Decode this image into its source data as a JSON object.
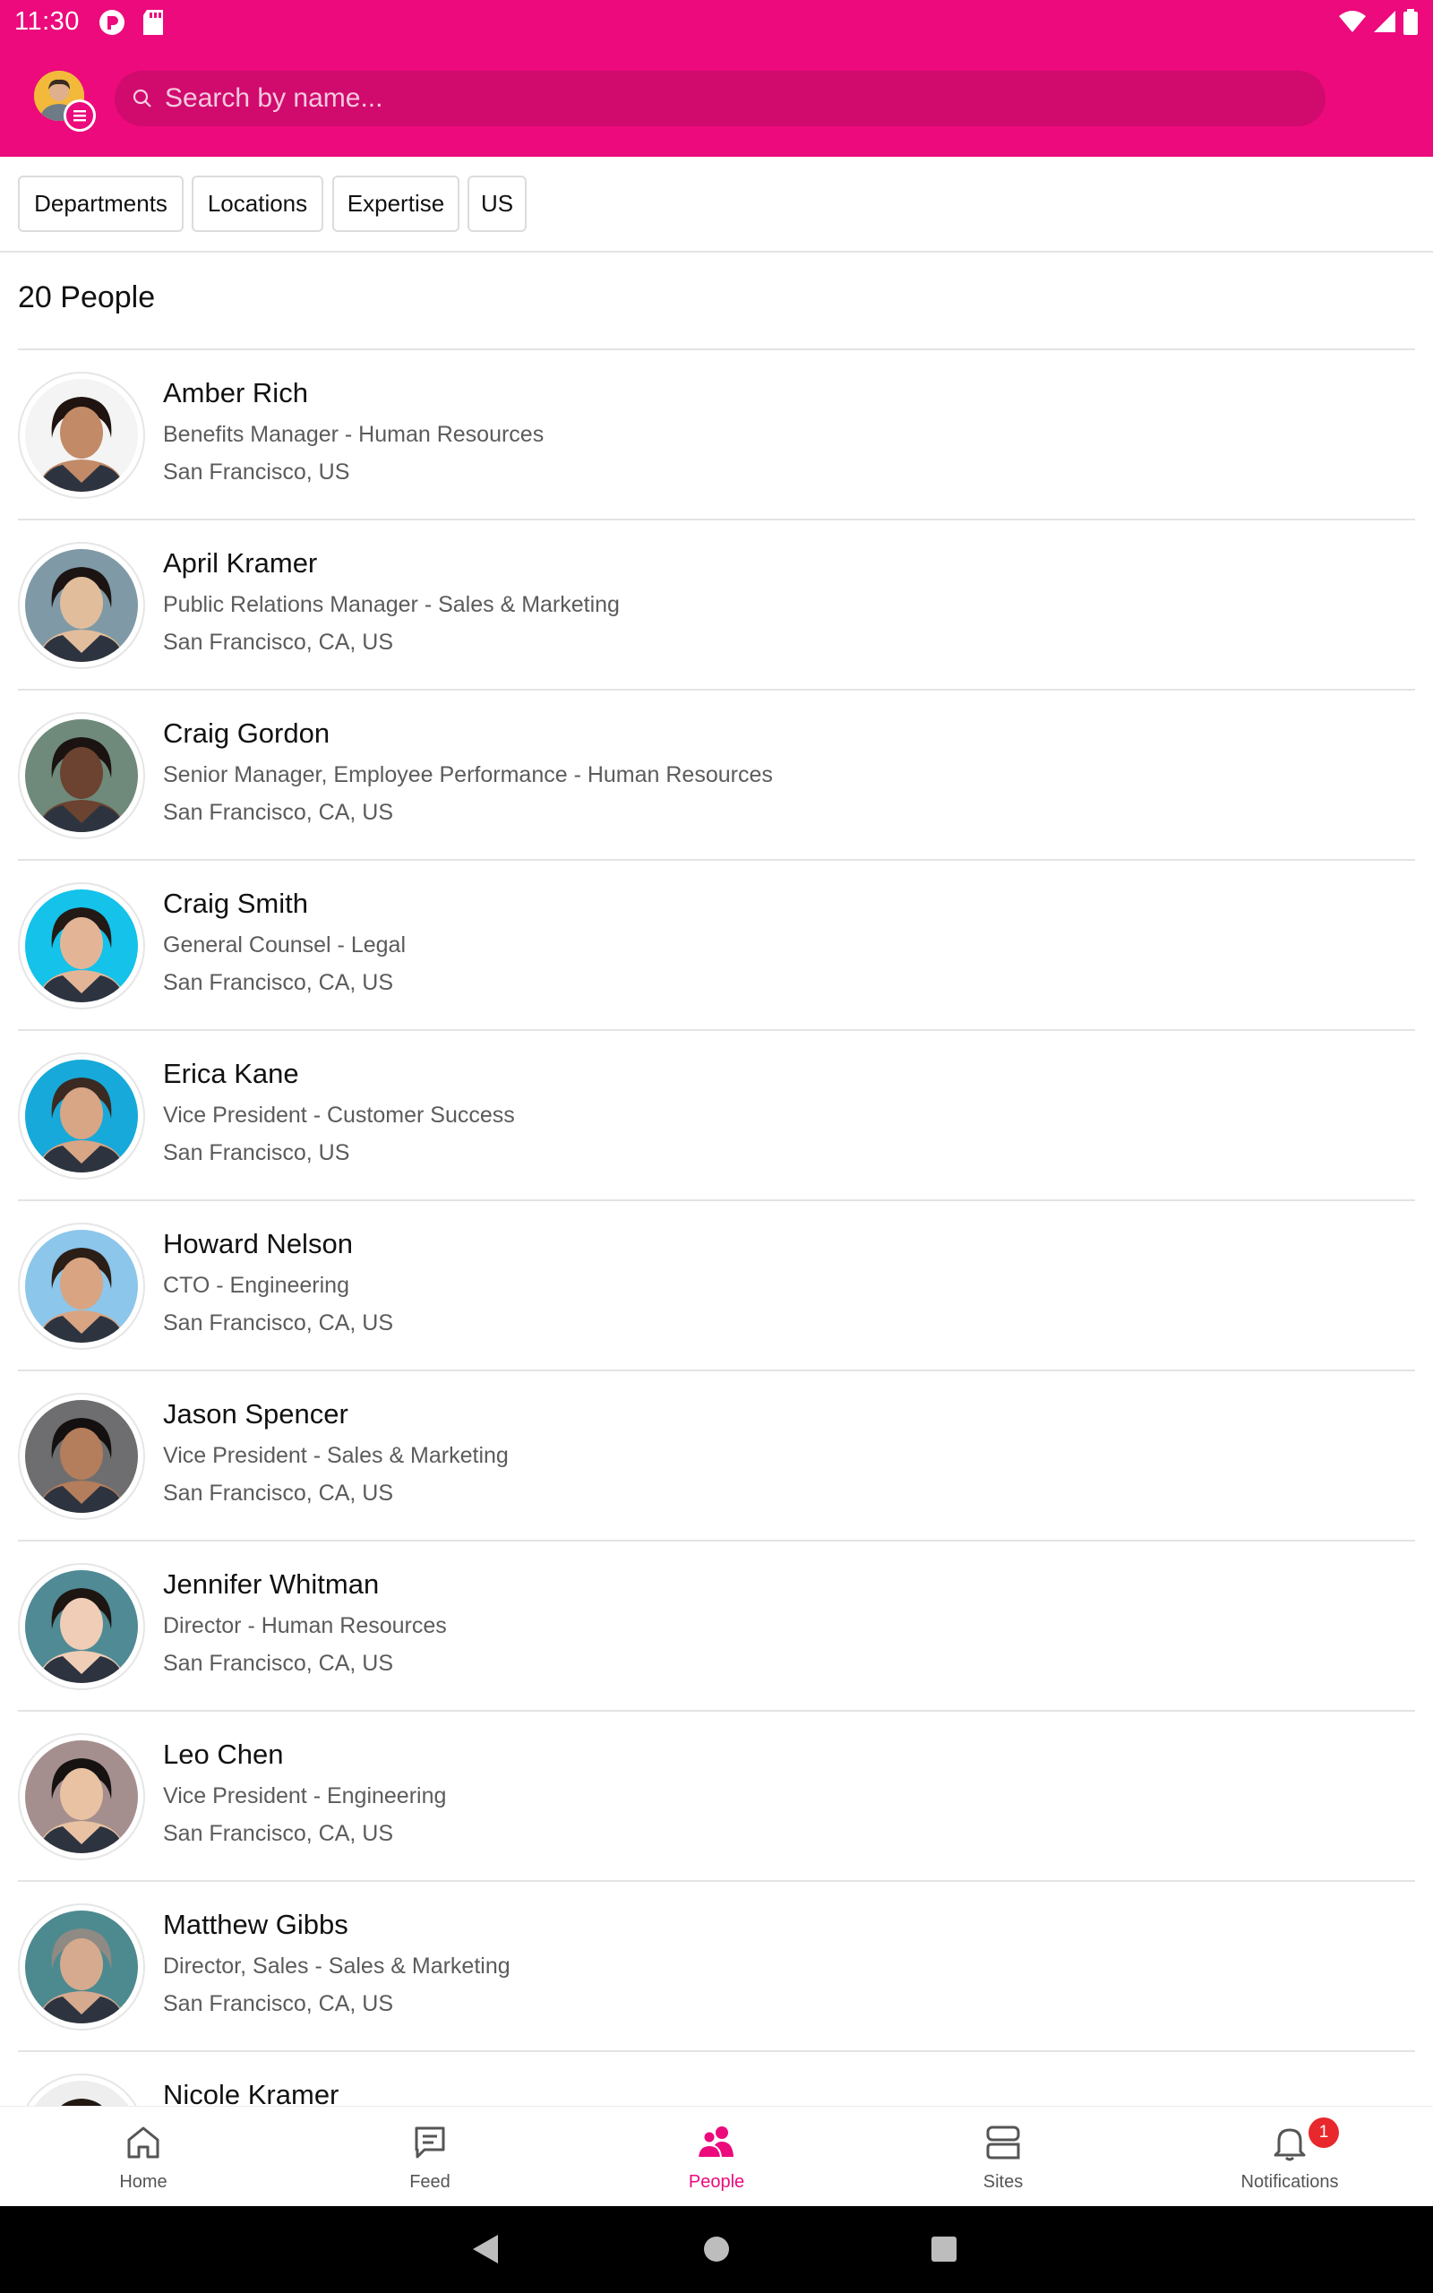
{
  "status_bar": {
    "time": "11:30"
  },
  "search": {
    "placeholder": "Search by name..."
  },
  "filters": [
    "Departments",
    "Locations",
    "Expertise",
    "US"
  ],
  "people_count": "20 People",
  "people": [
    {
      "name": "Amber Rich",
      "title": "Benefits Manager - Human Resources",
      "location": "San Francisco, US",
      "bg": "#f4f4f4",
      "skin": "#c28a66",
      "hair": "#1f1410"
    },
    {
      "name": "April Kramer",
      "title": "Public Relations Manager - Sales & Marketing",
      "location": "San Francisco, CA, US",
      "bg": "#7f9aa6",
      "skin": "#e2bd9c",
      "hair": "#1b1412"
    },
    {
      "name": "Craig Gordon",
      "title": "Senior Manager, Employee Performance - Human Resources",
      "location": "San Francisco, CA, US",
      "bg": "#6f8a7a",
      "skin": "#6b4330",
      "hair": "#1a1311"
    },
    {
      "name": "Craig Smith",
      "title": "General Counsel - Legal",
      "location": "San Francisco, CA, US",
      "bg": "#14c2ea",
      "skin": "#e3b596",
      "hair": "#231a16"
    },
    {
      "name": "Erica Kane",
      "title": "Vice President - Customer Success",
      "location": "San Francisco, US",
      "bg": "#17a9d9",
      "skin": "#d8a585",
      "hair": "#3a2a22"
    },
    {
      "name": "Howard Nelson",
      "title": "CTO - Engineering",
      "location": "San Francisco, CA, US",
      "bg": "#8cc6ea",
      "skin": "#d9a481",
      "hair": "#2b1e17"
    },
    {
      "name": "Jason Spencer",
      "title": "Vice President - Sales & Marketing",
      "location": "San Francisco, CA, US",
      "bg": "#6e6e70",
      "skin": "#b47d5b",
      "hair": "#141010"
    },
    {
      "name": "Jennifer Whitman",
      "title": "Director - Human Resources",
      "location": "San Francisco, CA, US",
      "bg": "#4f8a95",
      "skin": "#f0cdb6",
      "hair": "#1d1512"
    },
    {
      "name": "Leo Chen",
      "title": "Vice President - Engineering",
      "location": "San Francisco, CA, US",
      "bg": "#a58f8e",
      "skin": "#e8c2a2",
      "hair": "#161212"
    },
    {
      "name": "Matthew Gibbs",
      "title": "Director, Sales - Sales & Marketing",
      "location": "San Francisco, CA, US",
      "bg": "#4d8a90",
      "skin": "#d6aa8e",
      "hair": "#8f8a84"
    },
    {
      "name": "Nicole Kramer",
      "title": "",
      "location": "",
      "bg": "#eeeeee",
      "skin": "#d8ab8c",
      "hair": "#221812"
    }
  ],
  "bottom_nav": [
    {
      "label": "Home",
      "icon": "home-icon",
      "active": false
    },
    {
      "label": "Feed",
      "icon": "feed-icon",
      "active": false
    },
    {
      "label": "People",
      "icon": "people-icon",
      "active": true
    },
    {
      "label": "Sites",
      "icon": "sites-icon",
      "active": false
    },
    {
      "label": "Notifications",
      "icon": "bell-icon",
      "active": false,
      "badge": "1"
    }
  ],
  "colors": {
    "brand": "#ec0a7c",
    "badge": "#e8282d"
  }
}
